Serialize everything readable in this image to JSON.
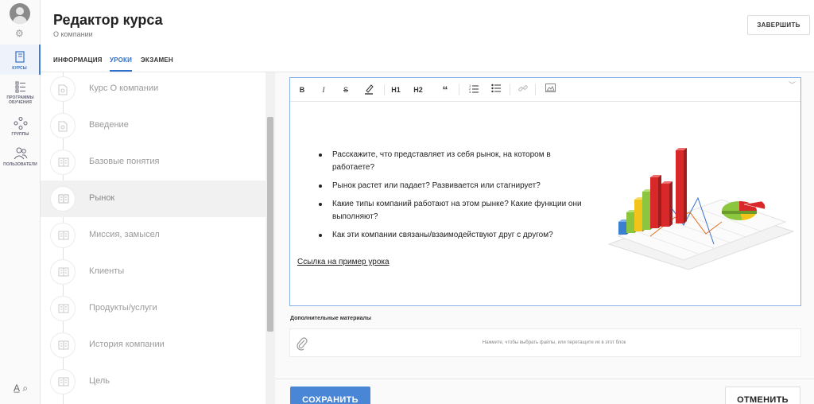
{
  "header": {
    "title": "Редактор курса",
    "subtitle": "О компании",
    "finish_label": "ЗАВЕРШИТЬ"
  },
  "tabs": [
    {
      "label": "ИНФОРМАЦИЯ",
      "active": false
    },
    {
      "label": "УРОКИ",
      "active": true
    },
    {
      "label": "ЭКЗАМЕН",
      "active": false
    }
  ],
  "nav": {
    "items": [
      {
        "label": "КУРСЫ",
        "icon": "courses-icon",
        "active": true
      },
      {
        "label": "ПРОГРАММЫ ОБУЧЕНИЯ",
        "icon": "programs-icon",
        "active": false
      },
      {
        "label": "ГРУППЫ",
        "icon": "groups-icon",
        "active": false
      },
      {
        "label": "ПОЛЬЗОВАТЕЛИ",
        "icon": "users-icon",
        "active": false
      }
    ],
    "bottom_icon": "accessibility-icon"
  },
  "lessons": [
    {
      "name": "Курс О компании",
      "icon": "document-icon",
      "active": false
    },
    {
      "name": "Введение",
      "icon": "document-icon",
      "active": false
    },
    {
      "name": "Базовые понятия",
      "icon": "book-icon",
      "active": false
    },
    {
      "name": "Рынок",
      "icon": "book-icon",
      "active": true
    },
    {
      "name": "Миссия, замысел",
      "icon": "book-icon",
      "active": false
    },
    {
      "name": "Клиенты",
      "icon": "book-icon",
      "active": false
    },
    {
      "name": "Продукты/услуги",
      "icon": "book-icon",
      "active": false
    },
    {
      "name": "История компании",
      "icon": "book-icon",
      "active": false
    },
    {
      "name": "Цель",
      "icon": "book-icon",
      "active": false
    }
  ],
  "toolbar": {
    "bold": "B",
    "italic": "I",
    "strike": "S",
    "h1": "H1",
    "h2": "H2",
    "quote": "“"
  },
  "editor": {
    "bullets": [
      "Расскажите, что представляет из себя рынок, на котором в работаете?",
      "Рынок растет или падает? Развивается или стагнирует?",
      "Какие типы компаний работают на этом рынке? Какие функции они выполняют?",
      "Как эти компании связаны/взаимодействуют друг с другом?"
    ],
    "link_text": "Ссылка на пример урока"
  },
  "materials": {
    "label": "Дополнительные материалы",
    "hint": "Нажмите, чтобы выбрать файлы, или перетащите их в этот блок"
  },
  "actions": {
    "save_label": "СОХРАНИТЬ",
    "cancel_label": "ОТМЕНИТЬ"
  },
  "colors": {
    "accent": "#2f6fc7",
    "save_button": "#4a86d6",
    "editor_border": "#8ab2e8"
  }
}
